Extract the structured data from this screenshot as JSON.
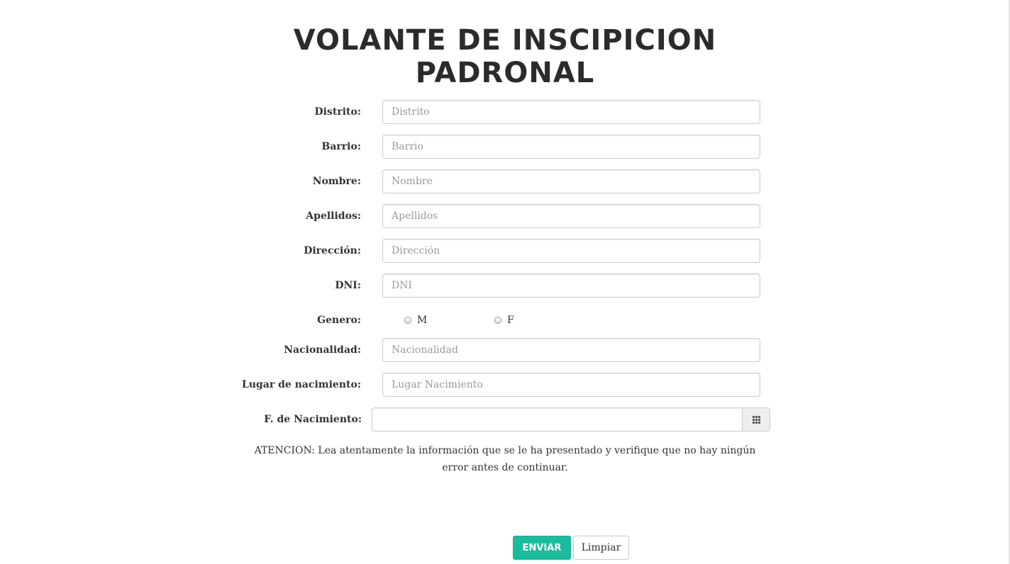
{
  "page": {
    "title": "VOLANTE DE INSCIPICION PADRONAL"
  },
  "form": {
    "fields": [
      {
        "label": "Distrito:",
        "placeholder": "Distrito",
        "value": ""
      },
      {
        "label": "Barrio:",
        "placeholder": "Barrio",
        "value": ""
      },
      {
        "label": "Nombre:",
        "placeholder": "Nombre",
        "value": ""
      },
      {
        "label": "Apellidos:",
        "placeholder": "Apellidos",
        "value": ""
      },
      {
        "label": "Dirección:",
        "placeholder": "Dirección",
        "value": ""
      },
      {
        "label": "DNI:",
        "placeholder": "DNI",
        "value": ""
      }
    ],
    "gender": {
      "label": "Genero:",
      "options": [
        "M",
        "F"
      ],
      "selected": ""
    },
    "nationality": {
      "label": "Nacionalidad:",
      "placeholder": "Nacionalidad",
      "value": ""
    },
    "birthplace": {
      "label": "Lugar de nacimiento:",
      "placeholder": "Lugar Nacimiento",
      "value": ""
    },
    "birthdate": {
      "label": "F. de Nacimiento:",
      "value": "",
      "icon": "calendar-grid-icon"
    }
  },
  "notice": {
    "text": "ATENCION: Lea atentamente la información que se le ha presentado y verifique que no hay ningún error antes de continuar."
  },
  "actions": {
    "submit_label": "ENVIAR",
    "reset_label": "Limpiar"
  },
  "colors": {
    "accent": "#1abc9c",
    "text": "#333333",
    "border": "#cccccc",
    "placeholder": "#999999"
  }
}
